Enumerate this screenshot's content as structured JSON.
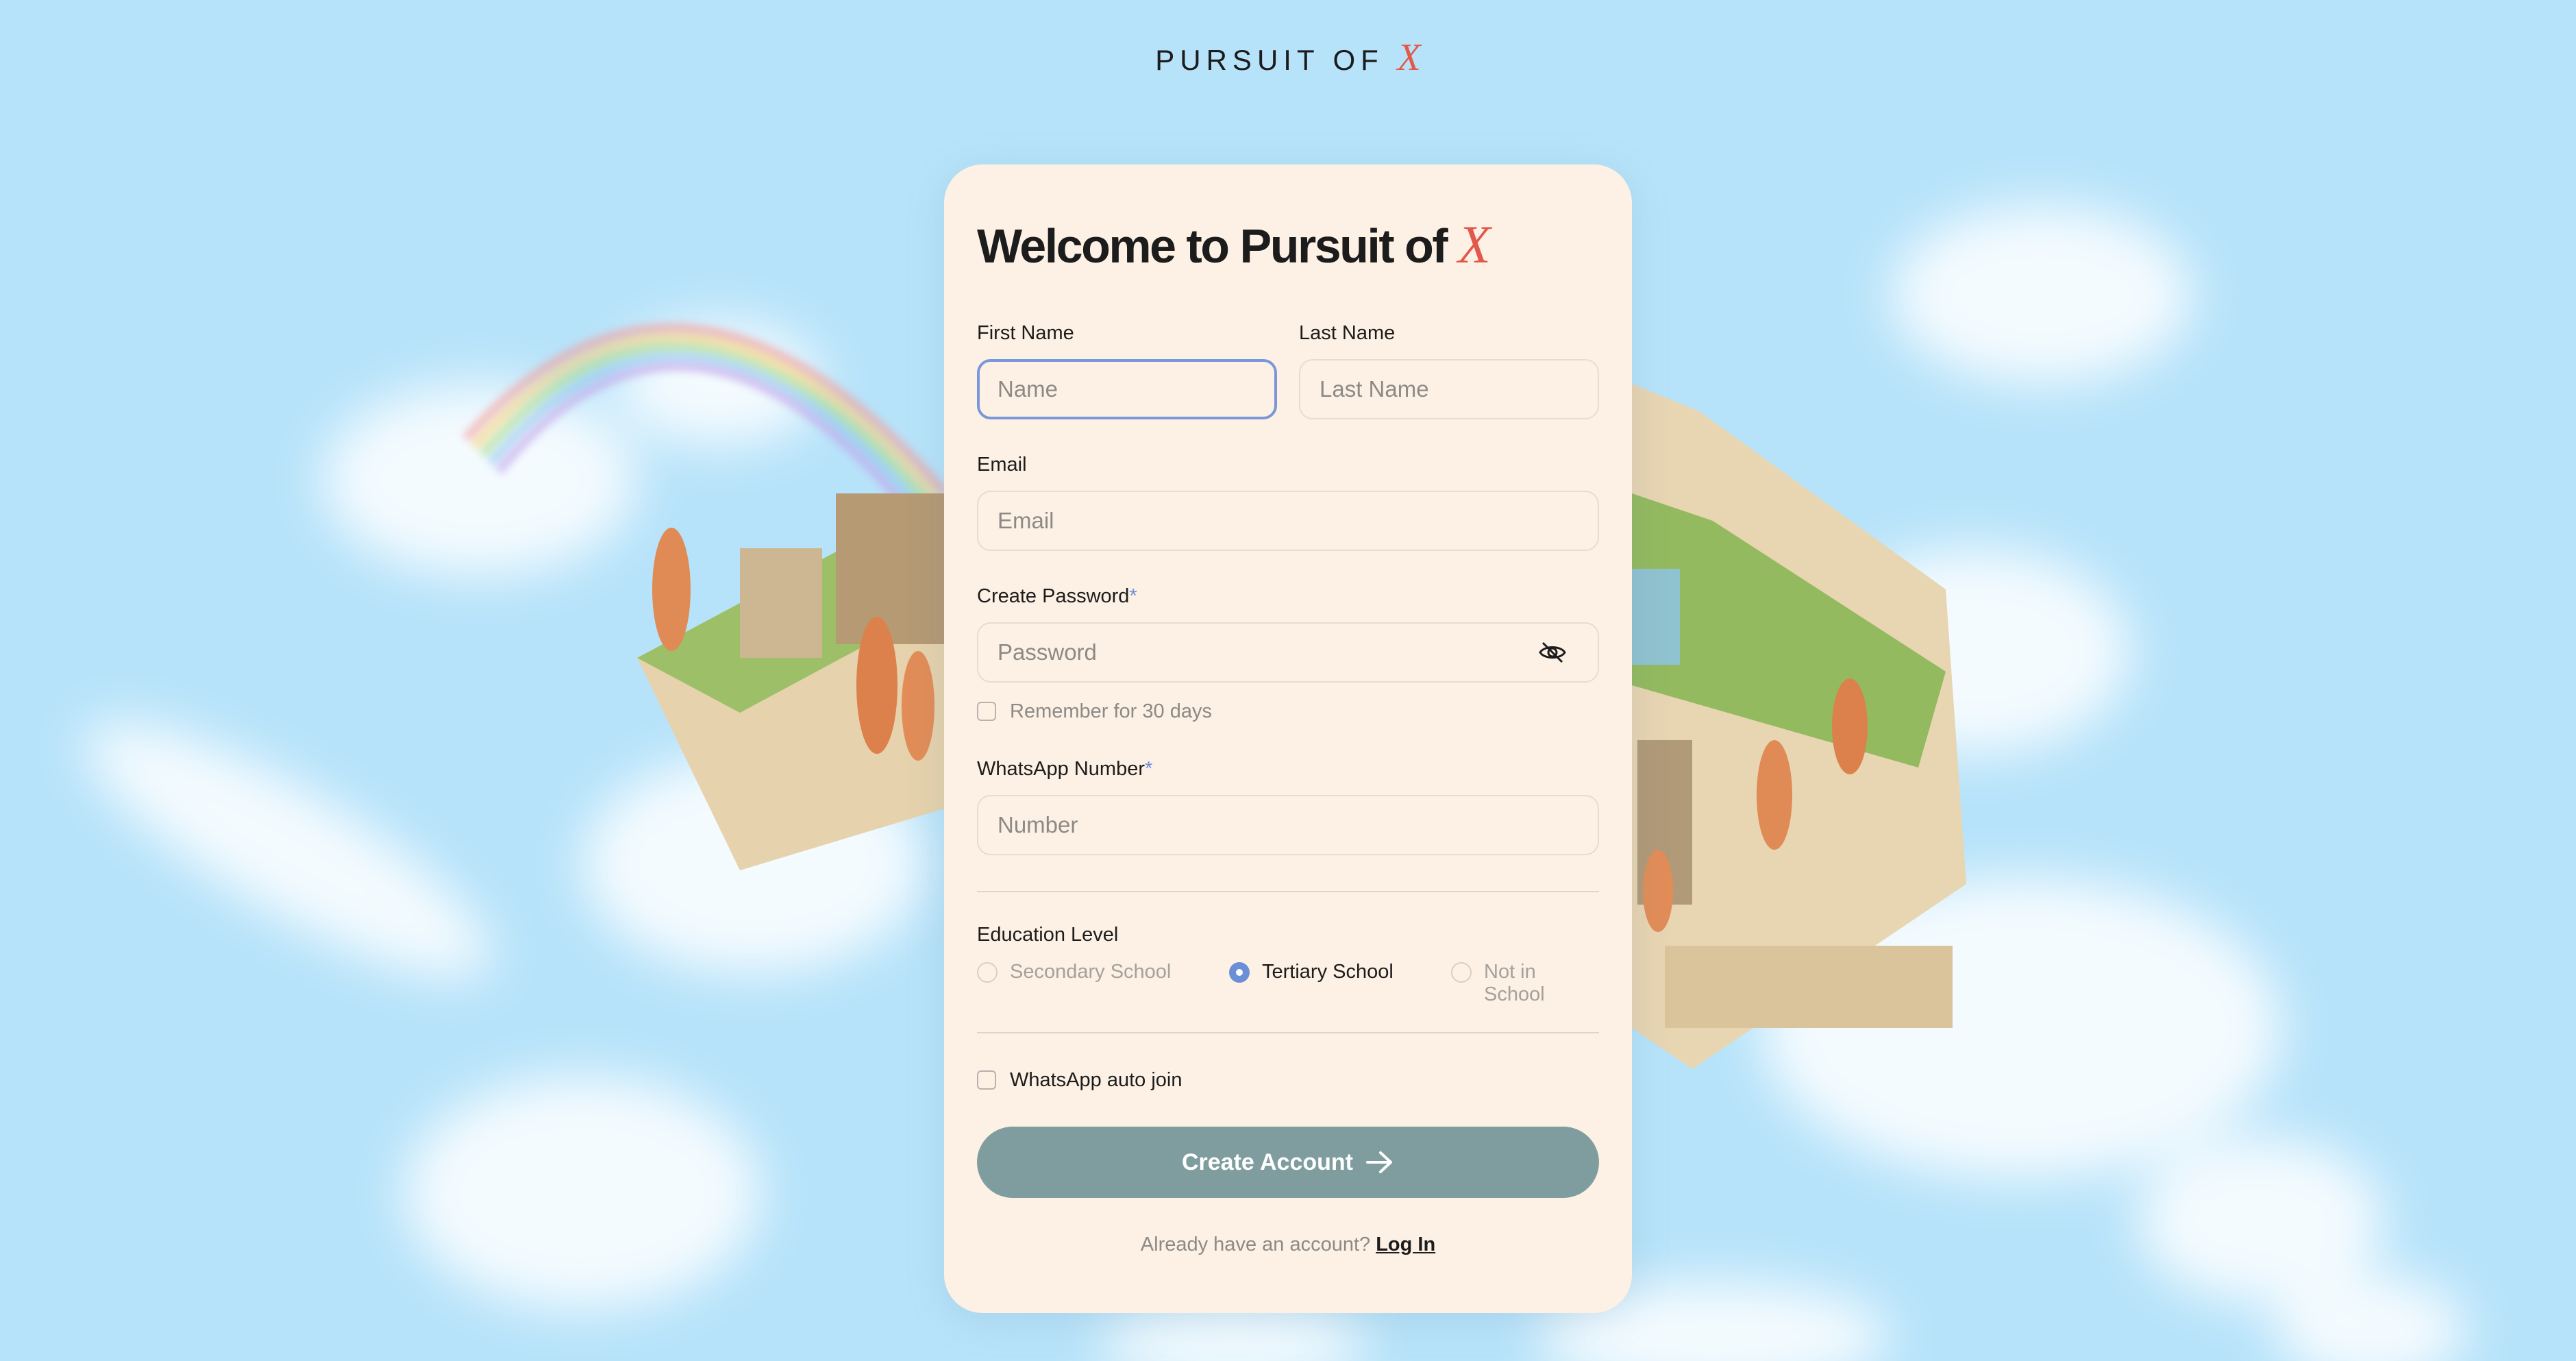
{
  "brand": {
    "text": "PURSUIT OF",
    "mark": "X"
  },
  "form": {
    "title": "Welcome to Pursuit of",
    "title_mark": "X",
    "first_name": {
      "label": "First Name",
      "placeholder": "Name"
    },
    "last_name": {
      "label": "Last Name",
      "placeholder": "Last Name"
    },
    "email": {
      "label": "Email",
      "placeholder": "Email"
    },
    "password": {
      "label": "Create Password",
      "required_mark": "*",
      "placeholder": "Password",
      "toggle_icon": "eye-off-icon"
    },
    "remember": {
      "label": "Remember for 30 days",
      "checked": false
    },
    "whatsapp": {
      "label": "WhatsApp Number",
      "required_mark": "*",
      "placeholder": "Number"
    },
    "education": {
      "label": "Education Level",
      "options": [
        "Secondary School",
        "Tertiary School",
        "Not in School"
      ],
      "selected": "Tertiary School"
    },
    "auto_join": {
      "label": "WhatsApp auto join",
      "checked": false
    },
    "submit": {
      "label": "Create Account",
      "icon": "arrow-right-icon"
    },
    "footer": {
      "text": "Already have an account?",
      "link": "Log In"
    }
  },
  "colors": {
    "accent": "#e2584a",
    "focus": "#7c97d9",
    "button": "#7f9d9f",
    "card": "#fdf1e5",
    "sky": "#b7e3fa"
  }
}
